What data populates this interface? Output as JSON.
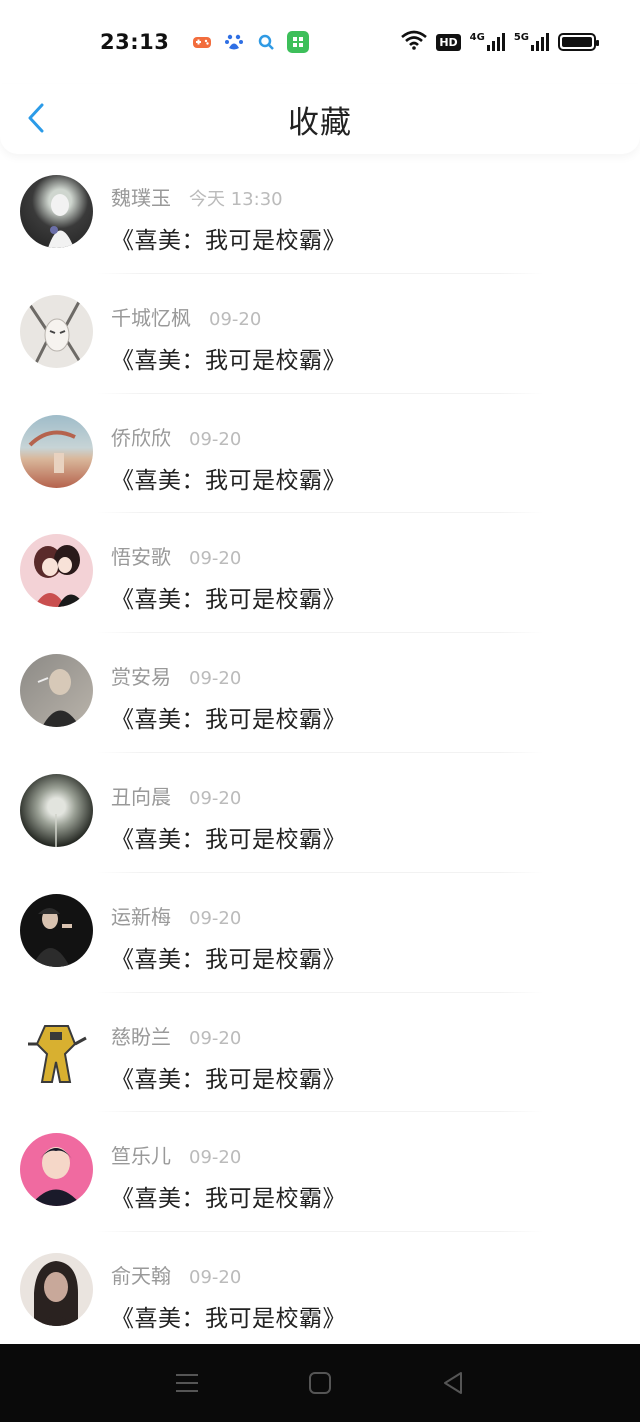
{
  "status_bar": {
    "time": "23:13",
    "apps": [
      {
        "icon": "game-icon",
        "color": "#f26d3d"
      },
      {
        "icon": "baidu-paw-icon",
        "color": "#2f6fe4"
      },
      {
        "icon": "search-app-icon",
        "color": "#2f9ae4"
      },
      {
        "icon": "green-app-icon",
        "color": "#3dbf5a"
      }
    ],
    "hd_label": "HD",
    "net1": "4G",
    "net2": "5G"
  },
  "header": {
    "title": "收藏",
    "back_icon": "chevron-left-icon",
    "accent": "#2b9be8"
  },
  "items": [
    {
      "name": "魏璞玉",
      "date": "今天 13:30",
      "work": "《喜美：我可是校霸》",
      "avatar_colors": [
        "#3a3a3a",
        "#cfd6cf",
        "#f2f2f2"
      ]
    },
    {
      "name": "千城忆枫",
      "date": "09-20",
      "work": "《喜美：我可是校霸》",
      "avatar_colors": [
        "#e9e6e2",
        "#6d6a66",
        "#b8b3ad"
      ]
    },
    {
      "name": "侨欣欣",
      "date": "09-20",
      "work": "《喜美：我可是校霸》",
      "avatar_colors": [
        "#9fbcc9",
        "#b5634d",
        "#d9b79b"
      ]
    },
    {
      "name": "悟安歌",
      "date": "09-20",
      "work": "《喜美：我可是校霸》",
      "avatar_colors": [
        "#f3d2d6",
        "#5a2a2a",
        "#c94f4f"
      ]
    },
    {
      "name": "赏安易",
      "date": "09-20",
      "work": "《喜美：我可是校霸》",
      "avatar_colors": [
        "#8c8a86",
        "#d7c9b8",
        "#2a2a2a"
      ]
    },
    {
      "name": "丑向晨",
      "date": "09-20",
      "work": "《喜美：我可是校霸》",
      "avatar_colors": [
        "#1c1f1a",
        "#9aa095",
        "#e2e4de"
      ]
    },
    {
      "name": "运新梅",
      "date": "09-20",
      "work": "《喜美：我可是校霸》",
      "avatar_colors": [
        "#121212",
        "#2c2c2c",
        "#d8c2b0"
      ]
    },
    {
      "name": "慈盼兰",
      "date": "09-20",
      "work": "《喜美：我可是校霸》",
      "avatar_colors": [
        "#ffffff",
        "#d8b030",
        "#3a3a3a"
      ]
    },
    {
      "name": "笪乐儿",
      "date": "09-20",
      "work": "《喜美：我可是校霸》",
      "avatar_colors": [
        "#f06aa0",
        "#1a1a2a",
        "#f5d7c8"
      ]
    },
    {
      "name": "俞天翰",
      "date": "09-20",
      "work": "《喜美：我可是校霸》",
      "avatar_colors": [
        "#eae4df",
        "#2a2220",
        "#c8a89a"
      ]
    }
  ],
  "nav_bar": {
    "menu_icon": "menu-icon",
    "home_icon": "home-square-icon",
    "back_icon": "back-triangle-icon"
  }
}
